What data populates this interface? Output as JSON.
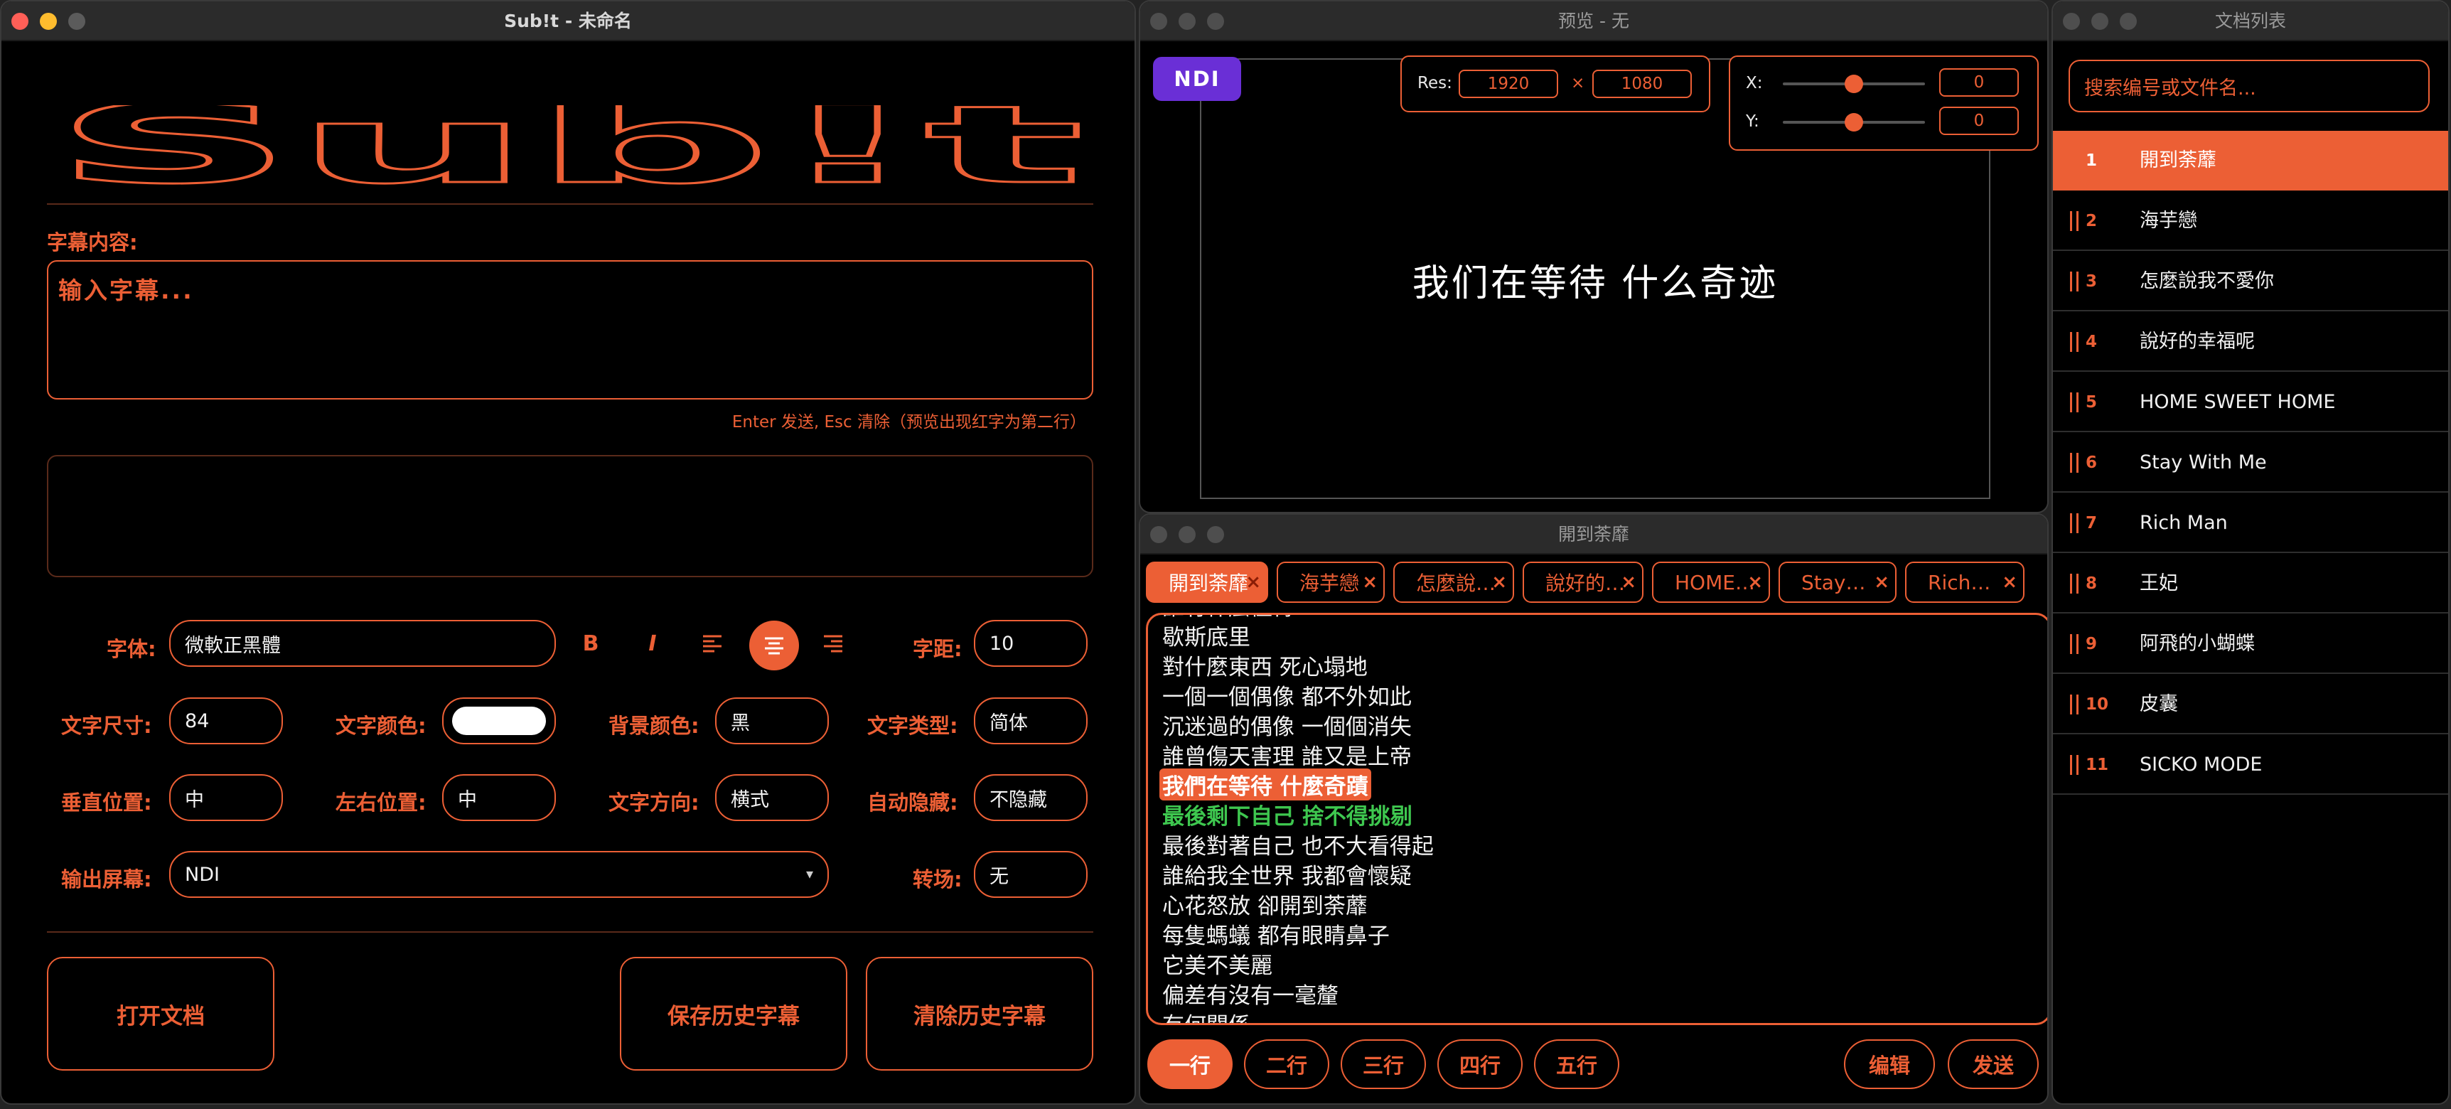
{
  "main_window": {
    "title": "Sub!t - 未命名",
    "subtitle_label": "字幕内容:",
    "subtitle_placeholder": "输入字幕...",
    "hint": "Enter 发送, Esc 清除（预览出现红字为第二行）",
    "font_label": "字体:",
    "font_value": "微軟正黑體",
    "bold": "B",
    "italic": "I",
    "spacing_label": "字距:",
    "spacing_value": "10",
    "size_label": "文字尺寸:",
    "size_value": "84",
    "text_color_label": "文字颜色:",
    "text_color": "#ffffff",
    "bg_color_label": "背景颜色:",
    "bg_color_value": "黑",
    "text_type_label": "文字类型:",
    "text_type_value": "简体",
    "vpos_label": "垂直位置:",
    "vpos_value": "中",
    "hpos_label": "左右位置:",
    "hpos_value": "中",
    "direction_label": "文字方向:",
    "direction_value": "横式",
    "autohide_label": "自动隐藏:",
    "autohide_value": "不隐藏",
    "output_label": "输出屏幕:",
    "output_value": "NDI",
    "transition_label": "转场:",
    "transition_value": "无",
    "open_doc": "打开文档",
    "save_history": "保存历史字幕",
    "clear_history": "清除历史字幕"
  },
  "preview": {
    "title": "预览 - 无",
    "ndi_badge": "NDI",
    "res_label": "Res:",
    "res_w": "1920",
    "res_sep": "×",
    "res_h": "1080",
    "x_label": "X:",
    "x_value": "0",
    "x_slider": 0.5,
    "y_label": "Y:",
    "y_value": "0",
    "y_slider": 0.5,
    "subtitle_text": "我们在等待 什么奇迹"
  },
  "document": {
    "title": "開到荼靡",
    "tabs": [
      "開到荼靡",
      "海芋戀",
      "怎麼說…",
      "說好的…",
      "HOME…",
      "Stay…",
      "Rich…"
    ],
    "lyrics": [
      "誰有什麼值得",
      "歇斯底里",
      "對什麼東西 死心塌地",
      "一個一個偶像 都不外如此",
      "沉迷過的偶像 一個個消失",
      "誰曾傷天害理 誰又是上帝",
      "我們在等待 什麼奇蹟",
      "最後剩下自己 捨不得挑剔",
      "最後對著自己 也不大看得起",
      "誰給我全世界 我都會懷疑",
      "心花怒放 卻開到荼蘼",
      "每隻螞蟻 都有眼睛鼻子",
      "它美不美麗",
      "偏差有沒有一毫釐",
      "有何關係"
    ],
    "current_index": 6,
    "next_index": 7,
    "line_buttons": [
      "一行",
      "二行",
      "三行",
      "四行",
      "五行"
    ],
    "edit": "编辑",
    "send": "发送"
  },
  "doclist": {
    "title": "文档列表",
    "search_placeholder": "搜索编号或文件名...",
    "items": [
      {
        "num": "1",
        "name": "開到荼蘼"
      },
      {
        "num": "2",
        "name": "海芋戀"
      },
      {
        "num": "3",
        "name": "怎麼說我不愛你"
      },
      {
        "num": "4",
        "name": "說好的幸福呢"
      },
      {
        "num": "5",
        "name": "HOME SWEET HOME"
      },
      {
        "num": "6",
        "name": "Stay With Me"
      },
      {
        "num": "7",
        "name": "Rich Man"
      },
      {
        "num": "8",
        "name": "王妃"
      },
      {
        "num": "9",
        "name": "阿飛的小蝴蝶"
      },
      {
        "num": "10",
        "name": "皮囊"
      },
      {
        "num": "11",
        "name": "SICKO MODE"
      }
    ]
  },
  "colors": {
    "accent": "#ec5f35",
    "ndi": "#6a2fd6",
    "next_line": "#3ec74f"
  },
  "logo_text": "Sub!t"
}
